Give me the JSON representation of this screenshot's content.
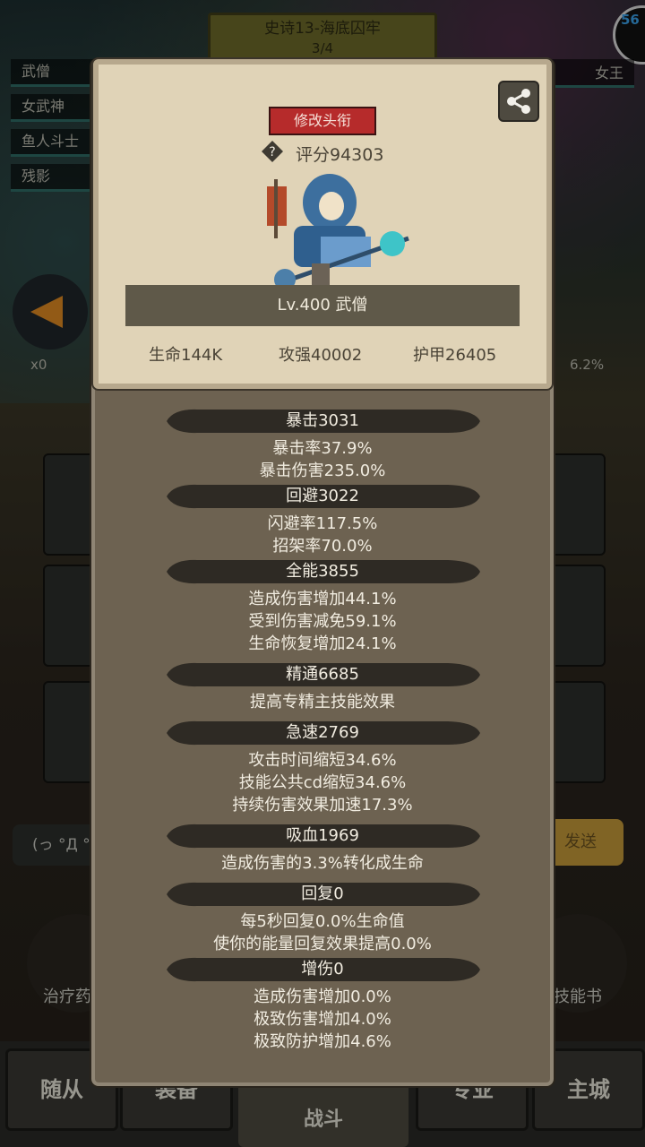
{
  "background": {
    "stage_title": "史诗13-海底囚牢",
    "stage_progress": "3/4",
    "fps": "56",
    "party": [
      "武僧",
      "女武神",
      "鱼人斗士",
      "残影"
    ],
    "enemy": "女王",
    "x0": "x0",
    "pct": "6.2%",
    "chat_placeholder": "(っ °Д °",
    "send_label": "发送",
    "item_left": "治疗药",
    "item_right": "技能书",
    "nav": {
      "follower": "随从",
      "equip": "装备",
      "battle": "战斗",
      "profession": "专业",
      "city": "主城"
    }
  },
  "card": {
    "edit_title_label": "修改头衔",
    "score_label": "评分94303",
    "level_class": "Lv.400 武僧",
    "hp": "生命144K",
    "attack": "攻强40002",
    "armor": "护甲26405"
  },
  "stats": [
    {
      "header": "暴击3031",
      "lines": [
        "暴击率37.9%",
        "暴击伤害235.0%"
      ]
    },
    {
      "header": "回避3022",
      "lines": [
        "闪避率117.5%",
        "招架率70.0%"
      ]
    },
    {
      "header": "全能3855",
      "lines": [
        "造成伤害增加44.1%",
        "受到伤害减免59.1%",
        "生命恢复增加24.1%"
      ]
    },
    {
      "header": "精通6685",
      "lines": [
        "提高专精主技能效果"
      ]
    },
    {
      "header": "急速2769",
      "lines": [
        "攻击时间缩短34.6%",
        "技能公共cd缩短34.6%",
        "持续伤害效果加速17.3%"
      ]
    },
    {
      "header": "吸血1969",
      "lines": [
        "造成伤害的3.3%转化成生命"
      ]
    },
    {
      "header": "回复0",
      "lines": [
        "每5秒回复0.0%生命值",
        "使你的能量回复效果提高0.0%"
      ]
    },
    {
      "header": "增伤0",
      "lines": [
        "造成伤害增加0.0%",
        "极致伤害增加4.0%",
        "极致防护增加4.6%"
      ]
    }
  ],
  "colors": {
    "panel": "#6d6251",
    "card": "#e0d3b7",
    "title_button": "#b62b2b",
    "header_bar": "#2e2a24"
  }
}
